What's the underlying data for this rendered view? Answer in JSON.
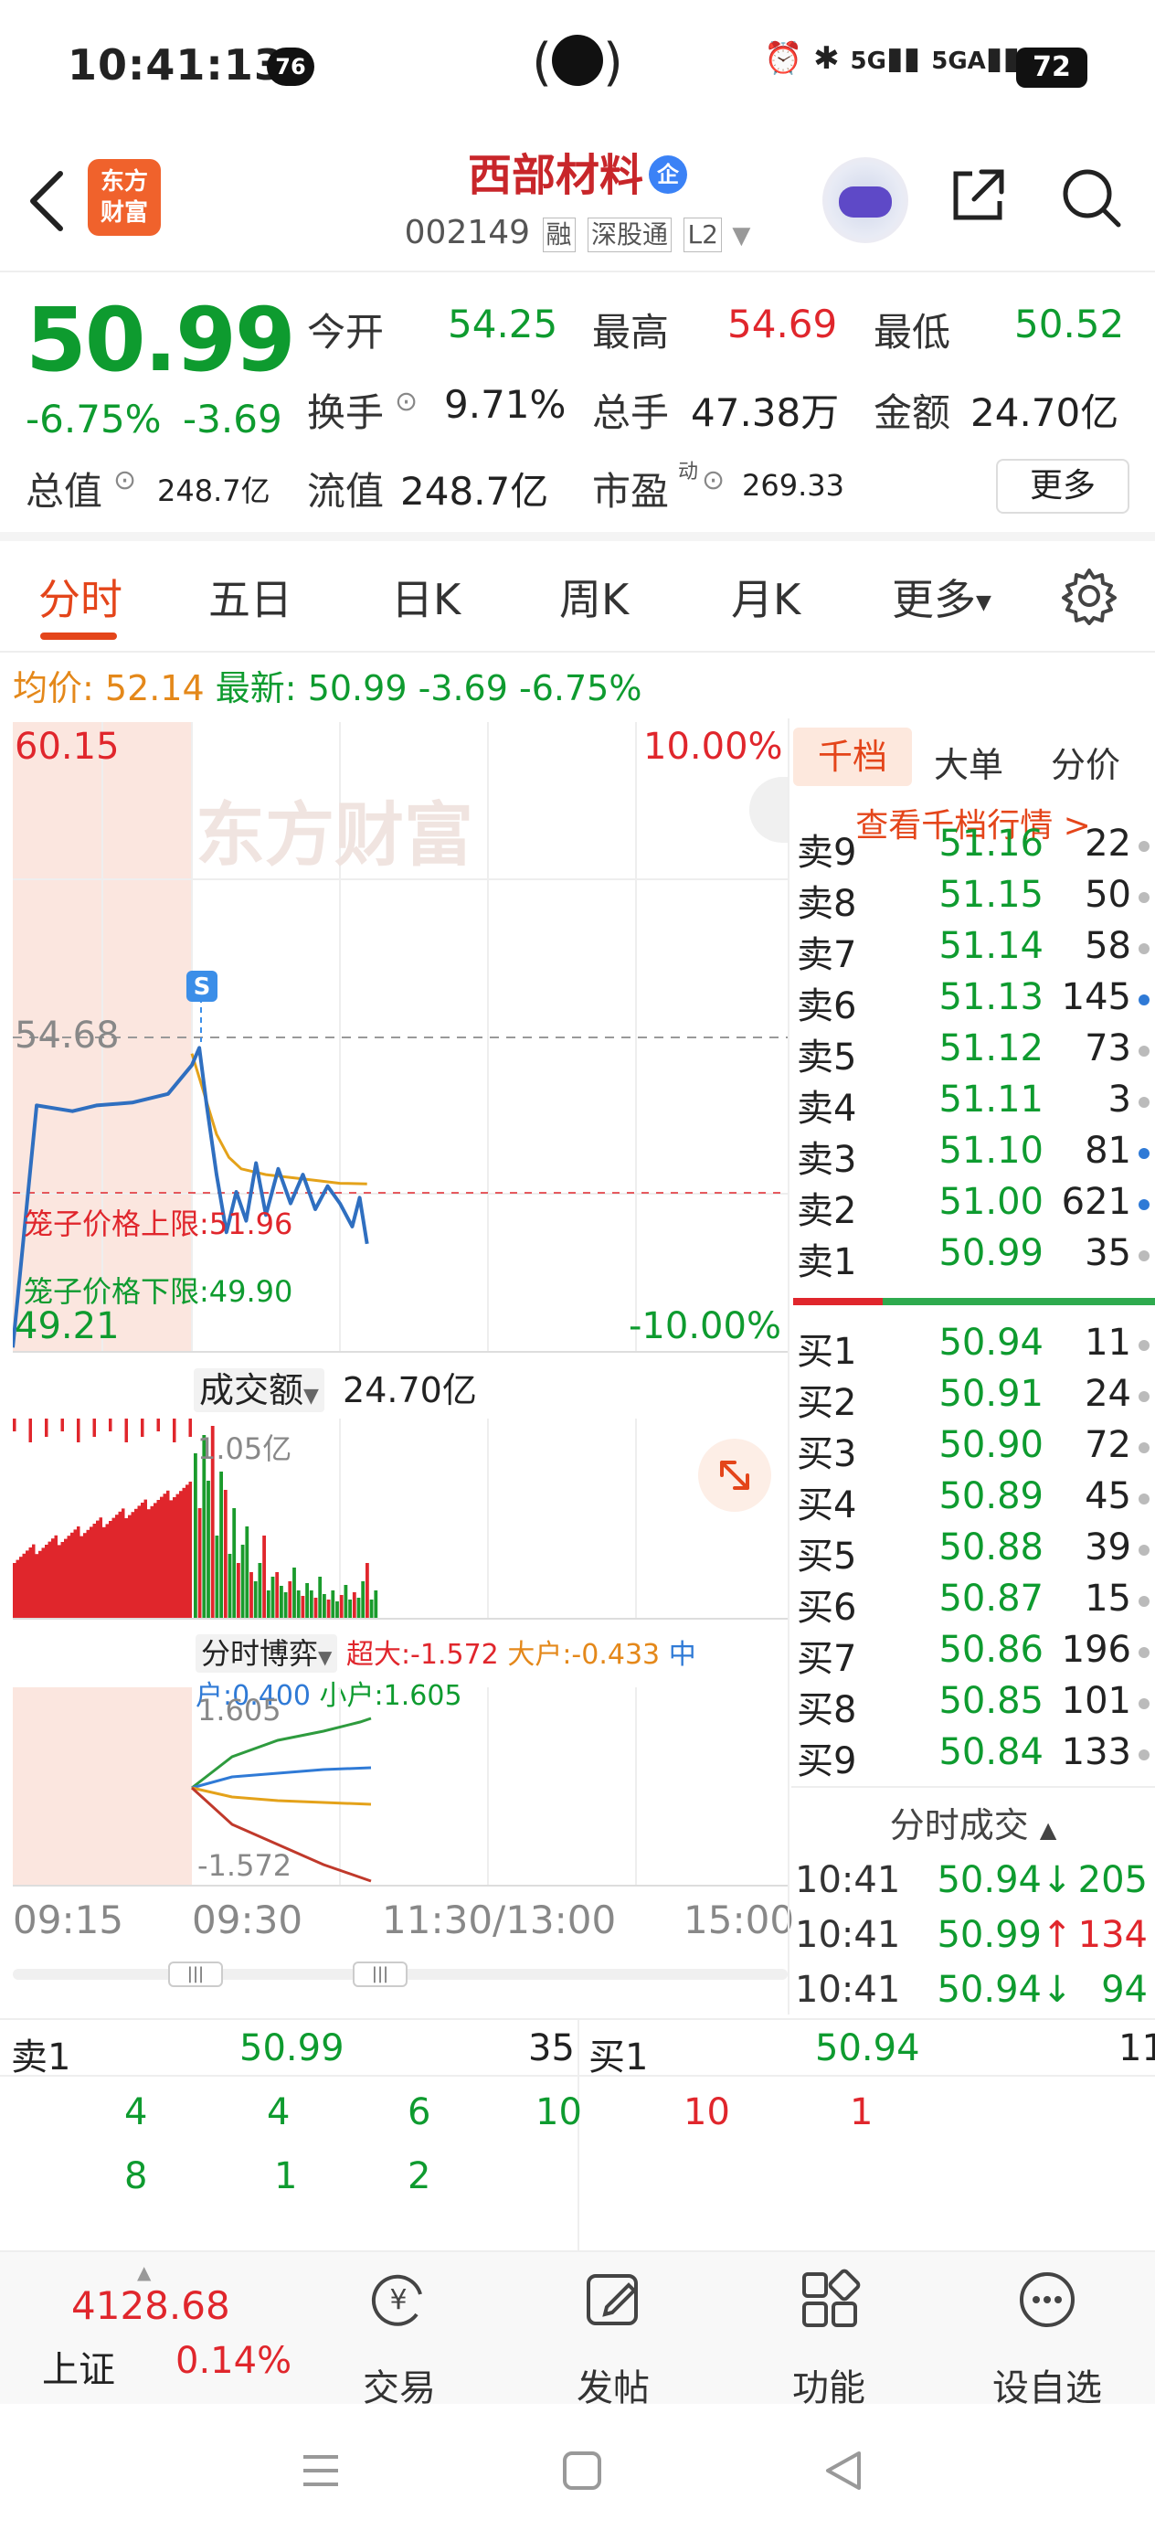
{
  "status_bar": {
    "time": "10:41:13",
    "notification_count": "76",
    "network_1": "5G",
    "network_2": "5GA",
    "battery": "72"
  },
  "header": {
    "logo_line1": "东方",
    "logo_line2": "财富",
    "stock_name": "西部材料",
    "name_badge": "企",
    "stock_code": "002149",
    "tags": [
      "融",
      "深股通",
      "L2"
    ]
  },
  "quote": {
    "price": "50.99",
    "change_pct": "-6.75%",
    "change_amt": "-3.69",
    "open_label": "今开",
    "open_value": "54.25",
    "high_label": "最高",
    "high_value": "54.69",
    "low_label": "最低",
    "low_value": "50.52",
    "turnover_label": "换手",
    "turnover_value": "9.71%",
    "volume_label": "总手",
    "volume_value": "47.38万",
    "amount_label": "金额",
    "amount_value": "24.70亿",
    "total_value_label": "总值",
    "total_value": "248.7亿",
    "float_value_label": "流值",
    "float_value": "248.7亿",
    "pe_label": "市盈",
    "pe_superscript": "动",
    "pe_value": "269.33",
    "more_label": "更多"
  },
  "tabs": [
    "分时",
    "五日",
    "日K",
    "周K",
    "月K",
    "更多"
  ],
  "avg_line": {
    "avg_label": "均价:",
    "avg_value": "52.14",
    "latest_label": "最新:",
    "latest_value": "50.99",
    "latest_chg": "-3.69",
    "latest_pct": "-6.75%"
  },
  "chart": {
    "top_price": "60.15",
    "top_pct": "10.00%",
    "bottom_price": "49.21",
    "bottom_pct": "-10.00%",
    "ref_price": "54.68",
    "cage_upper": "笼子价格上限:51.96",
    "cage_lower": "笼子价格下限:49.90",
    "marker": "S",
    "watermark": "东方财富"
  },
  "chart_data": {
    "type": "line",
    "title": "",
    "xlabel": "",
    "ylabel": "",
    "ylim": [
      49.21,
      60.15
    ],
    "x_ticks": [
      "09:15",
      "09:30",
      "11:30/13:00",
      "15:00"
    ],
    "series": [
      {
        "x": [
          "09:15",
          "09:17",
          "09:20",
          "09:22",
          "09:25",
          "09:28",
          "09:30",
          "09:33",
          "09:36",
          "09:40",
          "09:44",
          "09:48",
          "09:52",
          "09:56",
          "10:00",
          "10:05",
          "10:10",
          "10:15",
          "10:20",
          "10:25",
          "10:30",
          "10:35",
          "10:38",
          "10:41"
        ],
        "values": [
          49.3,
          53.5,
          53.4,
          53.5,
          53.55,
          53.7,
          54.2,
          54.5,
          53.5,
          52.3,
          51.3,
          52.0,
          51.5,
          52.5,
          51.6,
          52.4,
          51.8,
          52.3,
          51.7,
          52.1,
          51.8,
          51.4,
          51.9,
          51.1
        ]
      },
      {
        "x": [
          "09:30",
          "09:35",
          "09:40",
          "09:45",
          "09:50",
          "10:00",
          "10:10",
          "10:20",
          "10:30",
          "10:41"
        ],
        "values": [
          54.4,
          53.7,
          53.0,
          52.6,
          52.4,
          52.3,
          52.25,
          52.2,
          52.15,
          52.14
        ]
      }
    ]
  },
  "volume_chart": {
    "title": "成交额",
    "value": "24.70亿",
    "max_label": "1.05亿"
  },
  "flow_chart": {
    "title": "分时博弈",
    "super_label": "超大:-1.572",
    "large_label": "大户:-0.433",
    "medium_label": "中户:0.400",
    "small_label": "小户:1.605",
    "max_label": "1.605",
    "min_label": "-1.572"
  },
  "order_book": {
    "tabs": [
      "千档",
      "大单",
      "分价"
    ],
    "link": "查看千档行情 >",
    "asks": [
      {
        "label": "卖9",
        "price": "51.16",
        "vol": "22",
        "dot": "gray"
      },
      {
        "label": "卖8",
        "price": "51.15",
        "vol": "50",
        "dot": "gray"
      },
      {
        "label": "卖7",
        "price": "51.14",
        "vol": "58",
        "dot": "gray"
      },
      {
        "label": "卖6",
        "price": "51.13",
        "vol": "145",
        "dot": "blue"
      },
      {
        "label": "卖5",
        "price": "51.12",
        "vol": "73",
        "dot": "gray"
      },
      {
        "label": "卖4",
        "price": "51.11",
        "vol": "3",
        "dot": "gray"
      },
      {
        "label": "卖3",
        "price": "51.10",
        "vol": "81",
        "dot": "blue"
      },
      {
        "label": "卖2",
        "price": "51.00",
        "vol": "621",
        "dot": "blue"
      },
      {
        "label": "卖1",
        "price": "50.99",
        "vol": "35",
        "dot": "gray"
      }
    ],
    "bids": [
      {
        "label": "买1",
        "price": "50.94",
        "vol": "11",
        "dot": "gray"
      },
      {
        "label": "买2",
        "price": "50.91",
        "vol": "24",
        "dot": "gray"
      },
      {
        "label": "买3",
        "price": "50.90",
        "vol": "72",
        "dot": "gray"
      },
      {
        "label": "买4",
        "price": "50.89",
        "vol": "45",
        "dot": "gray"
      },
      {
        "label": "买5",
        "price": "50.88",
        "vol": "39",
        "dot": "gray"
      },
      {
        "label": "买6",
        "price": "50.87",
        "vol": "15",
        "dot": "gray"
      },
      {
        "label": "买7",
        "price": "50.86",
        "vol": "196",
        "dot": "gray"
      },
      {
        "label": "买8",
        "price": "50.85",
        "vol": "101",
        "dot": "gray"
      },
      {
        "label": "买9",
        "price": "50.84",
        "vol": "133",
        "dot": "gray"
      }
    ],
    "ticks_title": "分时成交",
    "ticks": [
      {
        "time": "10:41",
        "price": "50.94",
        "dir": "↓",
        "vol": "205"
      },
      {
        "time": "10:41",
        "price": "50.99",
        "dir": "↑",
        "vol": "134"
      },
      {
        "time": "10:41",
        "price": "50.94",
        "dir": "↓",
        "vol": "94"
      }
    ]
  },
  "levels": {
    "sell_label": "卖1",
    "sell_price": "50.99",
    "sell_vol": "35",
    "buy_label": "买1",
    "buy_price": "50.94",
    "buy_vol": "11",
    "sell_row1": [
      "4",
      "4",
      "6",
      "10"
    ],
    "sell_row2": [
      "8",
      "1",
      "2"
    ],
    "buy_row1": [
      "10",
      "1"
    ]
  },
  "bottom_nav": {
    "index_value": "4128.68",
    "index_name": "上证",
    "index_pct": "0.14%",
    "items": [
      "交易",
      "发帖",
      "功能",
      "设自选"
    ]
  }
}
